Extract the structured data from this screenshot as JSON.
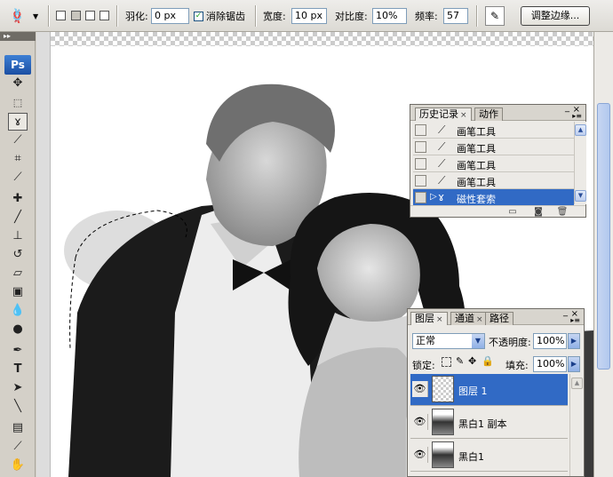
{
  "options_bar": {
    "feather_label": "羽化:",
    "feather_value": "0 px",
    "antialias_label": "消除锯齿",
    "antialias_checked": true,
    "width_label": "宽度:",
    "width_value": "10 px",
    "contrast_label": "对比度:",
    "contrast_value": "10%",
    "frequency_label": "频率:",
    "frequency_value": "57",
    "refine_edge_label": "调整边缘..."
  },
  "toolbox": {
    "logo": "Ps",
    "tools": [
      "move-tool",
      "marquee-tool",
      "magnetic-lasso-tool",
      "magic-wand-tool",
      "crop-tool",
      "eyedropper-tool",
      "healing-brush-tool",
      "brush-tool",
      "clone-stamp-tool",
      "history-brush-tool",
      "eraser-tool",
      "gradient-tool",
      "blur-tool",
      "dodge-tool",
      "pen-tool",
      "type-tool",
      "path-selection-tool",
      "line-tool",
      "notes-tool",
      "eyedropper-sample-tool",
      "hand-tool"
    ]
  },
  "history_panel": {
    "tabs": [
      {
        "label": "历史记录",
        "active": true
      },
      {
        "label": "动作",
        "active": false
      }
    ],
    "items": [
      {
        "label": "画笔工具",
        "icon": "brush-icon",
        "selected": false
      },
      {
        "label": "画笔工具",
        "icon": "brush-icon",
        "selected": false
      },
      {
        "label": "画笔工具",
        "icon": "brush-icon",
        "selected": false
      },
      {
        "label": "画笔工具",
        "icon": "brush-icon",
        "selected": false
      },
      {
        "label": "磁性套索",
        "icon": "magnetic-lasso-icon",
        "selected": true
      }
    ]
  },
  "layers_panel": {
    "tabs": [
      {
        "label": "图层",
        "active": true
      },
      {
        "label": "通道",
        "active": false
      },
      {
        "label": "路径",
        "active": false
      }
    ],
    "blend_mode": "正常",
    "opacity_label": "不透明度:",
    "opacity_value": "100%",
    "lock_label": "锁定:",
    "fill_label": "填充:",
    "fill_value": "100%",
    "layers": [
      {
        "name": "图层 1",
        "selected": true,
        "visible": true
      },
      {
        "name": "黑白1 副本",
        "selected": false,
        "visible": true
      },
      {
        "name": "黑白1",
        "selected": false,
        "visible": true
      }
    ]
  },
  "colors": {
    "selection_blue": "#316ac5",
    "panel_bg": "#eceae6"
  }
}
